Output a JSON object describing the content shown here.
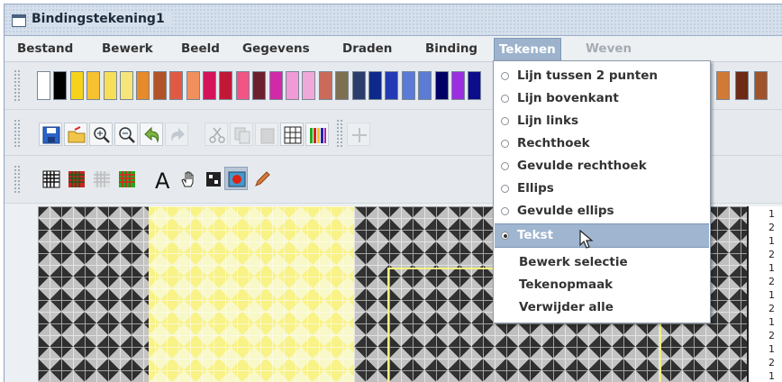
{
  "window": {
    "title": "Bindingstekening1"
  },
  "menubar": {
    "items": [
      {
        "label": "Bestand"
      },
      {
        "label": "Bewerk"
      },
      {
        "label": "Beeld"
      },
      {
        "label": "Gegevens"
      },
      {
        "label": "Draden"
      },
      {
        "label": "Binding"
      },
      {
        "label": "Tekenen"
      },
      {
        "label": "Weven"
      }
    ]
  },
  "palette": {
    "colors": [
      "#ffffff",
      "#000000",
      "#f6d31a",
      "#f6c232",
      "#f7df57",
      "#f6e67a",
      "#e8892a",
      "#b3532a",
      "#e05a43",
      "#f2905d",
      "#d4145a",
      "#c21837",
      "#f05586",
      "#6d1f2f",
      "#d02aa8",
      "#f19ad7",
      "#f0a8d9",
      "#c96a5a",
      "#7e6f50",
      "#2a3e6c",
      "#0d2a8a",
      "#243ab4",
      "#5b79d6",
      "#5c7bd3",
      "#000066",
      "#9a2ee0",
      "#0c0c8c"
    ],
    "right_colors": [
      "#d07a35",
      "#6d2a15",
      "#a0532a"
    ]
  },
  "dropdown": {
    "items": [
      {
        "label": "Lijn tussen 2 punten",
        "type": "radio",
        "checked": false
      },
      {
        "label": "Lijn bovenkant",
        "type": "radio",
        "checked": false
      },
      {
        "label": "Lijn links",
        "type": "radio",
        "checked": false
      },
      {
        "label": "Rechthoek",
        "type": "radio",
        "checked": false
      },
      {
        "label": "Gevulde rechthoek",
        "type": "radio",
        "checked": false
      },
      {
        "label": "Ellips",
        "type": "radio",
        "checked": false
      },
      {
        "label": "Gevulde ellips",
        "type": "radio",
        "checked": false
      },
      {
        "label": "Tekst",
        "type": "radio",
        "checked": true
      },
      {
        "label": "Bewerk selectie",
        "type": "plain"
      },
      {
        "label": "Tekenopmaak",
        "type": "plain"
      },
      {
        "label": "Verwijder alle",
        "type": "plain"
      }
    ]
  },
  "right_panel": {
    "numbers": [
      "1",
      "2",
      "1",
      "2",
      "1",
      "2",
      "1",
      "2",
      "1",
      "2",
      "1",
      "2",
      "1"
    ]
  },
  "icons": {
    "toolbar1": [
      "save-icon",
      "open-icon",
      "zoom-in-icon",
      "zoom-out-icon",
      "undo-icon",
      "redo-icon",
      "cut-icon",
      "copy-icon",
      "paste-icon",
      "grid-icon",
      "color-bars-icon"
    ],
    "toolbar2": [
      "grid-black-icon",
      "grid-red-icon",
      "grid-gray-icon",
      "grid-pattern-icon",
      "text-tool-icon",
      "hand-tool-icon",
      "scroll-tool-icon",
      "fill-tool-icon",
      "pencil-tool-icon"
    ]
  }
}
